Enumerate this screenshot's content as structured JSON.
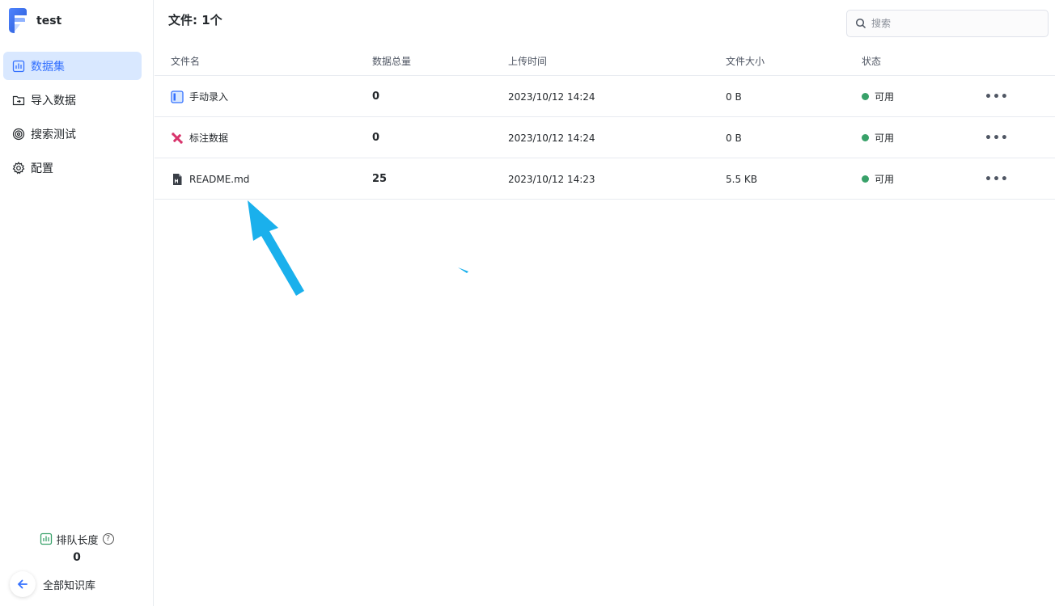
{
  "app": {
    "name": "test",
    "brand_color": "#3370ff"
  },
  "sidebar": {
    "items": [
      {
        "label": "数据集",
        "icon": "dataset-icon",
        "active": true
      },
      {
        "label": "导入数据",
        "icon": "folder-import-icon",
        "active": false
      },
      {
        "label": "搜索测试",
        "icon": "target-icon",
        "active": false
      },
      {
        "label": "配置",
        "icon": "gear-icon",
        "active": false
      }
    ],
    "queue_label": "排队长度",
    "queue_count": "0",
    "back_label": "全部知识库"
  },
  "main": {
    "title": "文件: 1个",
    "search_placeholder": "搜索",
    "columns": [
      "文件名",
      "数据总量",
      "上传时间",
      "文件大小",
      "状态"
    ],
    "rows": [
      {
        "name": "手动录入",
        "icon": "manual-entry-icon",
        "count": "0",
        "time": "2023/10/12 14:24",
        "size": "0 B",
        "status": "可用"
      },
      {
        "name": "标注数据",
        "icon": "annotation-icon",
        "count": "0",
        "time": "2023/10/12 14:24",
        "size": "0 B",
        "status": "可用"
      },
      {
        "name": "README.md",
        "icon": "markdown-file-icon",
        "count": "25",
        "time": "2023/10/12 14:23",
        "size": "5.5 KB",
        "status": "可用"
      }
    ],
    "more_label": "•••"
  },
  "colors": {
    "status_ok": "#38a169",
    "annotation_arrow": "#1ab0ec"
  }
}
